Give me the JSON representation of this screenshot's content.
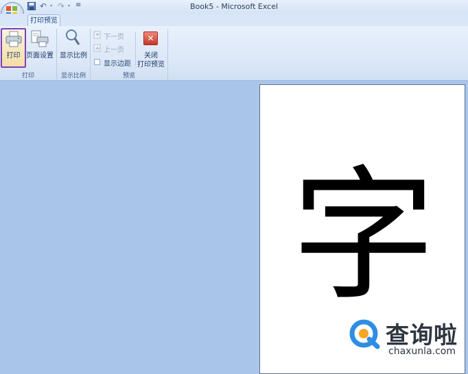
{
  "window": {
    "title": "Book5 - Microsoft Excel"
  },
  "quick_access": {
    "save_icon": "save-icon",
    "undo_glyph": "↶",
    "redo_glyph": "↷",
    "dropdown_glyph": "▾",
    "customize_glyph": "≡"
  },
  "tabs": [
    {
      "label": "打印预览",
      "active": true
    }
  ],
  "ribbon": {
    "groups": {
      "print": {
        "label": "打印",
        "buttons": {
          "print": "打印",
          "page_setup": "页面设置"
        }
      },
      "zoom": {
        "label": "显示比例",
        "buttons": {
          "zoom": "显示比例"
        }
      },
      "preview": {
        "label": "预览",
        "next_page": "下一页",
        "previous_page": "上一页",
        "show_margins": "显示边距",
        "close_line1": "关闭",
        "close_line2": "打印预览",
        "close_glyph": "✕"
      }
    }
  },
  "page": {
    "content": "字"
  },
  "watermark": {
    "text": "查询啦",
    "url": "chaxunla.com"
  },
  "colors": {
    "workspace": "#a9c5ea",
    "print_highlight": "#7e3fb9",
    "watermark_blue": "#2f8de4",
    "watermark_orange": "#f5a623"
  }
}
